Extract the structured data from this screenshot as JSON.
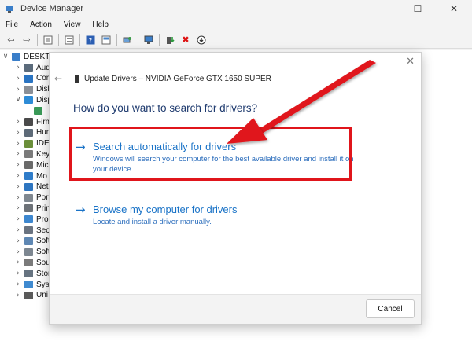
{
  "window": {
    "title": "Device Manager",
    "minimize": "—",
    "maximize": "☐",
    "close": "✕"
  },
  "menu": [
    "File",
    "Action",
    "View",
    "Help"
  ],
  "tree": {
    "root": "DESKTOP",
    "items": [
      {
        "label": "Aud",
        "icon_color": "#5b6b7b"
      },
      {
        "label": "Cor",
        "icon_color": "#2a74c2"
      },
      {
        "label": "Disk",
        "icon_color": "#8a8f96"
      },
      {
        "label": "Disp",
        "icon_color": "#2d8bd6"
      },
      {
        "label": "",
        "icon_color": "#3a9a58"
      },
      {
        "label": "Firm",
        "icon_color": "#4a4a4a"
      },
      {
        "label": "Hur",
        "icon_color": "#5d6a78"
      },
      {
        "label": "IDE",
        "icon_color": "#6b8f3a"
      },
      {
        "label": "Key",
        "icon_color": "#7a7a7a"
      },
      {
        "label": "Mic",
        "icon_color": "#6a6a6a"
      },
      {
        "label": "Mo",
        "icon_color": "#2f7cc9"
      },
      {
        "label": "Net",
        "icon_color": "#2e75c0"
      },
      {
        "label": "Por",
        "icon_color": "#808890"
      },
      {
        "label": "Prin",
        "icon_color": "#6d7278"
      },
      {
        "label": "Pro",
        "icon_color": "#3d87cf"
      },
      {
        "label": "Sec",
        "icon_color": "#6a7380"
      },
      {
        "label": "Soft",
        "icon_color": "#5e87b3"
      },
      {
        "label": "Soft",
        "icon_color": "#7d8791"
      },
      {
        "label": "Sou",
        "icon_color": "#7a7a7a"
      },
      {
        "label": "Stor",
        "icon_color": "#667380"
      },
      {
        "label": "Syst",
        "icon_color": "#3f8ad0"
      },
      {
        "label": "Uni",
        "icon_color": "#5a5a5a"
      }
    ]
  },
  "dialog": {
    "close": "✕",
    "back": "←",
    "title": "Update Drivers – NVIDIA GeForce GTX 1650 SUPER",
    "question": "How do you want to search for drivers?",
    "option_auto": {
      "arrow": "→",
      "title": "Search automatically for drivers",
      "description": "Windows will search your computer for the best available driver and install it on your device."
    },
    "option_browse": {
      "arrow": "→",
      "title": "Browse my computer for drivers",
      "description": "Locate and install a driver manually."
    },
    "cancel": "Cancel"
  },
  "colors": {
    "link": "#1a73c7",
    "highlight": "#e0151b",
    "annotation_arrow": "#e0151b"
  }
}
